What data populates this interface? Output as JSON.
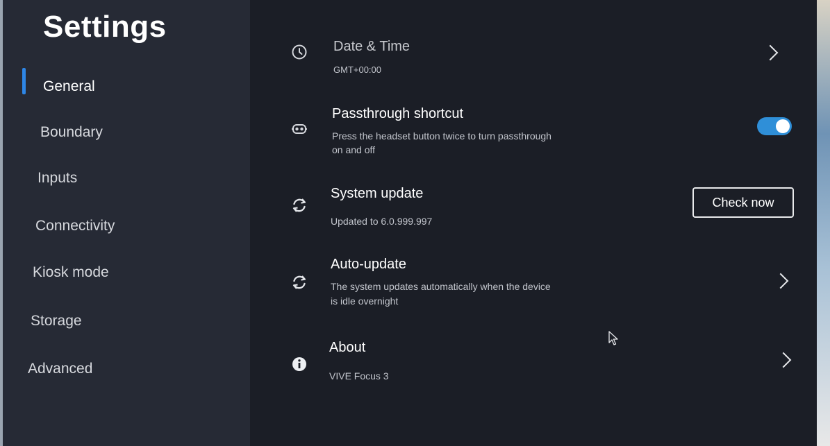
{
  "sidebar": {
    "title": "Settings",
    "items": [
      {
        "label": "General",
        "active": true
      },
      {
        "label": "Boundary"
      },
      {
        "label": "Inputs"
      },
      {
        "label": "Connectivity"
      },
      {
        "label": "Kiosk mode"
      },
      {
        "label": "Storage"
      },
      {
        "label": "Advanced"
      }
    ]
  },
  "main": {
    "date_time": {
      "title": "Date & Time",
      "subtitle": "GMT+00:00",
      "icon": "clock-icon"
    },
    "passthrough": {
      "title": "Passthrough shortcut",
      "subtitle_line1": "Press the headset button twice to turn passthrough",
      "subtitle_line2": "on and off",
      "icon": "headset-icon",
      "toggle_on": true
    },
    "system_update": {
      "title": "System update",
      "subtitle": "Updated to 6.0.999.997",
      "icon": "refresh-icon",
      "button_label": "Check now"
    },
    "auto_update": {
      "title": "Auto-update",
      "subtitle_line1": "The system updates automatically when the device",
      "subtitle_line2": "is idle overnight",
      "icon": "refresh-icon"
    },
    "about": {
      "title": "About",
      "subtitle": "VIVE Focus 3",
      "icon": "info-icon"
    }
  },
  "colors": {
    "accent": "#2e86e6",
    "toggle_on": "#2f8fd8",
    "sidebar_bg": "#262a35",
    "main_bg": "#1b1e26"
  }
}
